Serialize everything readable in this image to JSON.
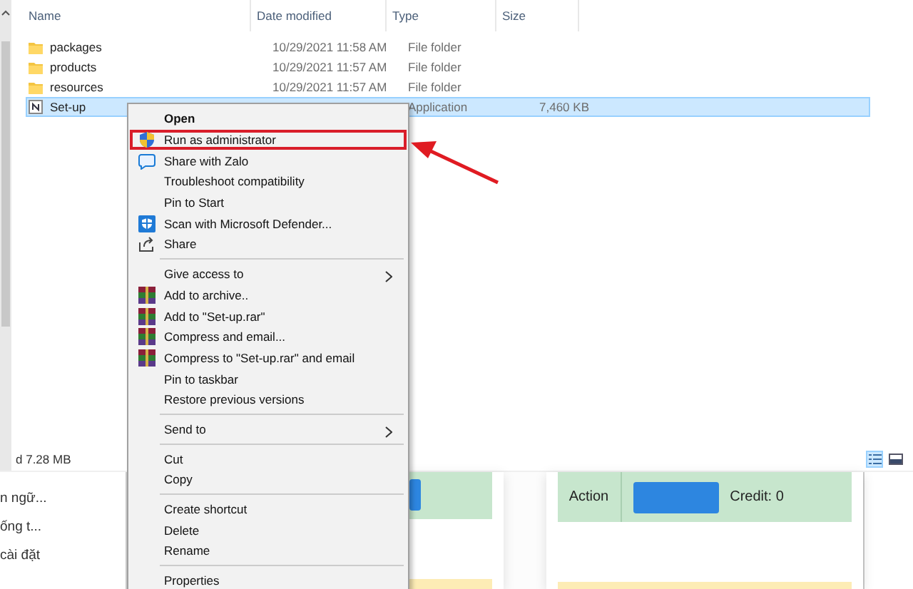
{
  "explorer": {
    "columns": [
      {
        "label": "Name"
      },
      {
        "label": "Date modified"
      },
      {
        "label": "Type"
      },
      {
        "label": "Size"
      }
    ],
    "rows": [
      {
        "kind": "folder",
        "name": "packages",
        "date": "10/29/2021 11:58 AM",
        "type": "File folder",
        "selected": false
      },
      {
        "kind": "folder",
        "name": "products",
        "date": "10/29/2021 11:57 AM",
        "type": "File folder",
        "selected": false
      },
      {
        "kind": "folder",
        "name": "resources",
        "date": "10/29/2021 11:57 AM",
        "type": "File folder",
        "selected": false
      },
      {
        "kind": "app",
        "name": "Set-up",
        "type": "Application",
        "size": "7,460 KB",
        "selected": true
      }
    ],
    "status": "d  7.28 MB"
  },
  "background_page": {
    "sidebar_items": [
      "n ngữ...",
      "ống t...",
      "cài đặt"
    ],
    "cards": [
      {
        "label": "Action",
        "credit": "Credit: 0"
      }
    ]
  },
  "context_menu": {
    "items": [
      {
        "kind": "plain",
        "label": "Open",
        "default": true,
        "highlighted": false,
        "submenu": false
      },
      {
        "kind": "shield",
        "label": "Run as administrator",
        "default": false,
        "highlighted": true,
        "submenu": false
      },
      {
        "kind": "chat",
        "label": "Share with Zalo",
        "default": false,
        "highlighted": false,
        "submenu": false
      },
      {
        "kind": "plain",
        "label": "Troubleshoot compatibility",
        "default": false,
        "highlighted": false,
        "submenu": false
      },
      {
        "kind": "plain",
        "label": "Pin to Start",
        "default": false,
        "highlighted": false,
        "submenu": false
      },
      {
        "kind": "defender",
        "label": "Scan with Microsoft Defender...",
        "default": false,
        "highlighted": false,
        "submenu": false
      },
      {
        "kind": "share",
        "label": "Share",
        "default": false,
        "highlighted": false,
        "submenu": false
      },
      {
        "kind": "separator"
      },
      {
        "kind": "plain",
        "label": "Give access to",
        "default": false,
        "highlighted": false,
        "submenu": true
      },
      {
        "kind": "archive",
        "label": "Add to archive..",
        "default": false,
        "highlighted": false,
        "submenu": false
      },
      {
        "kind": "archive",
        "label": "Add to \"Set-up.rar\"",
        "default": false,
        "highlighted": false,
        "submenu": false
      },
      {
        "kind": "archive",
        "label": "Compress and email...",
        "default": false,
        "highlighted": false,
        "submenu": false
      },
      {
        "kind": "archive",
        "label": "Compress to \"Set-up.rar\" and email",
        "default": false,
        "highlighted": false,
        "submenu": false
      },
      {
        "kind": "plain",
        "label": "Pin to taskbar",
        "default": false,
        "highlighted": false,
        "submenu": false
      },
      {
        "kind": "plain",
        "label": "Restore previous versions",
        "default": false,
        "highlighted": false,
        "submenu": false
      },
      {
        "kind": "separator"
      },
      {
        "kind": "plain",
        "label": "Send to",
        "default": false,
        "highlighted": false,
        "submenu": true
      },
      {
        "kind": "separator"
      },
      {
        "kind": "plain",
        "label": "Cut",
        "default": false,
        "highlighted": false,
        "submenu": false
      },
      {
        "kind": "plain",
        "label": "Copy",
        "default": false,
        "highlighted": false,
        "submenu": false
      },
      {
        "kind": "separator"
      },
      {
        "kind": "plain",
        "label": "Create shortcut",
        "default": false,
        "highlighted": false,
        "submenu": false
      },
      {
        "kind": "plain",
        "label": "Delete",
        "default": false,
        "highlighted": false,
        "submenu": false
      },
      {
        "kind": "plain",
        "label": "Rename",
        "default": false,
        "highlighted": false,
        "submenu": false
      },
      {
        "kind": "separator"
      },
      {
        "kind": "plain",
        "label": "Properties",
        "default": false,
        "highlighted": false,
        "submenu": false
      }
    ]
  }
}
